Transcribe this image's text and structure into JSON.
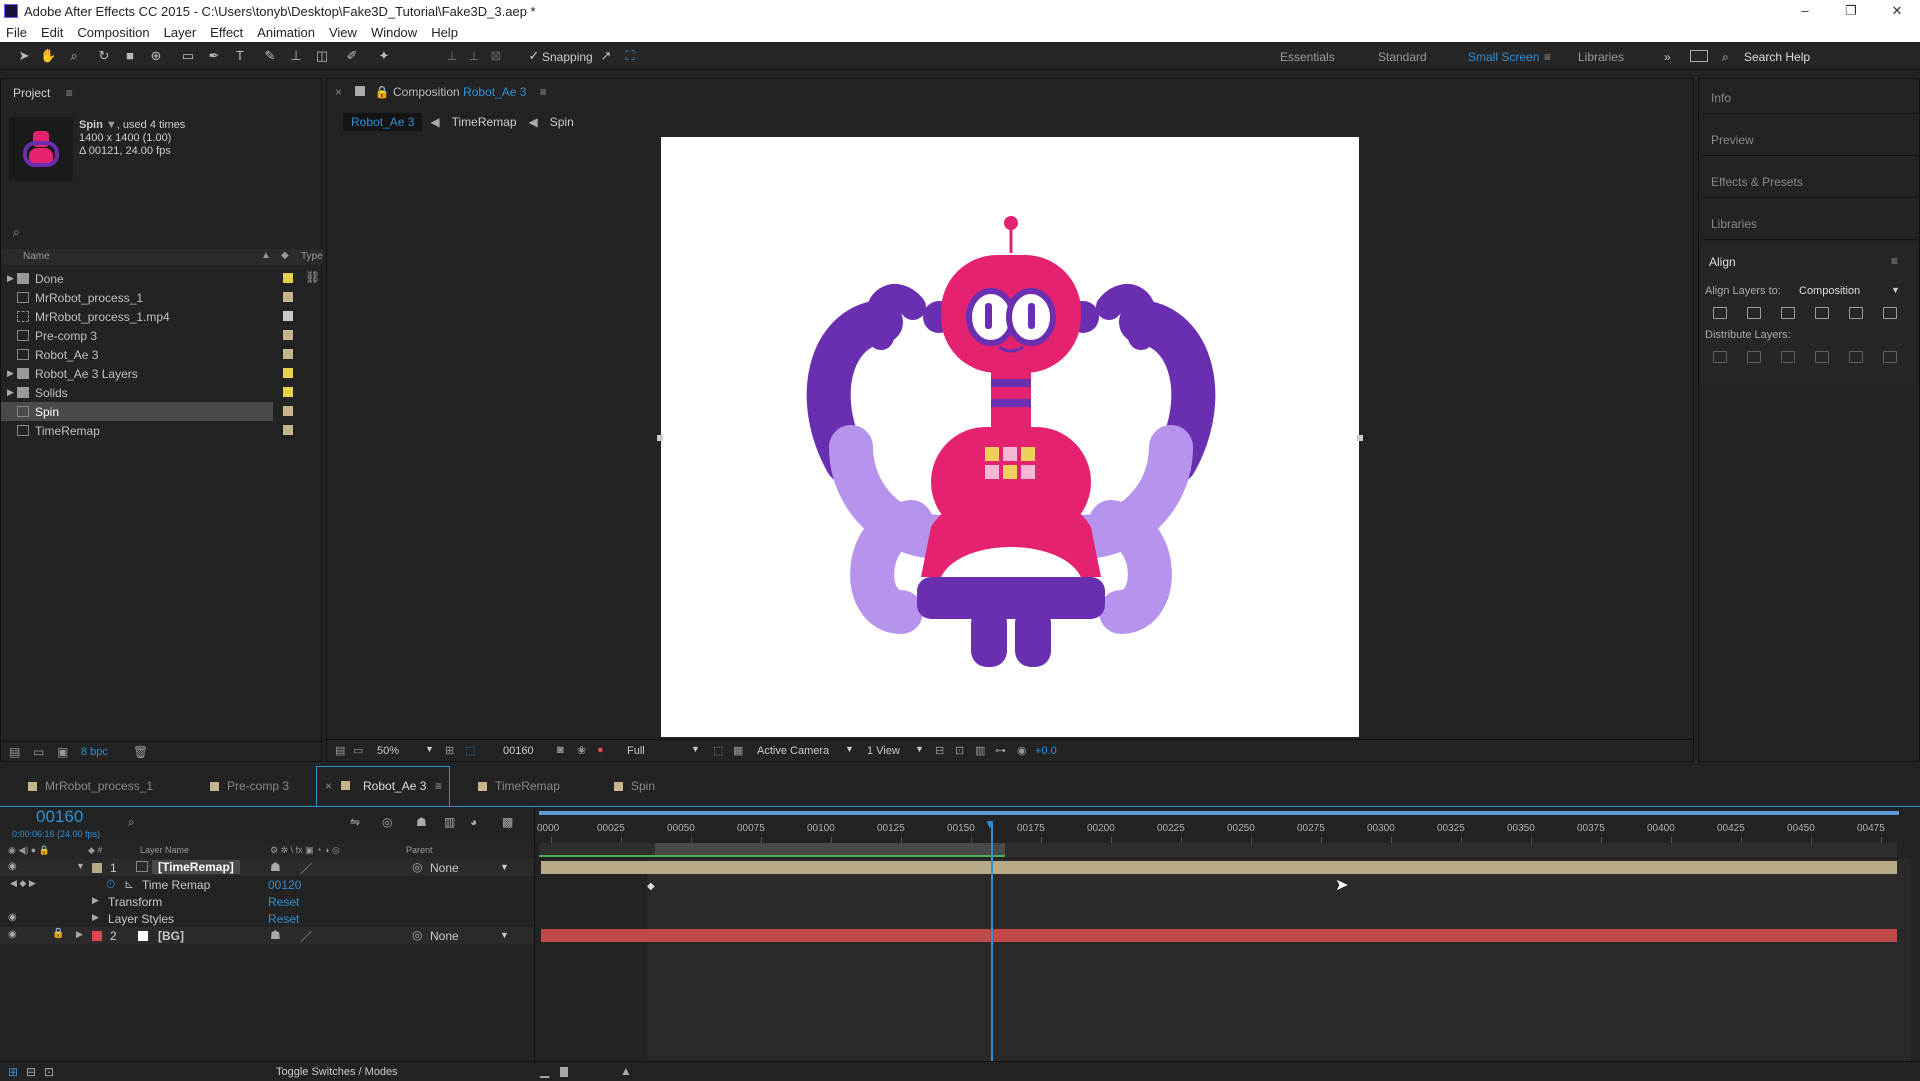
{
  "window": {
    "title": "Adobe After Effects CC 2015 - C:\\Users\\tonyb\\Desktop\\Fake3D_Tutorial\\Fake3D_3.aep *",
    "controls": [
      "–",
      "❐",
      "✕"
    ]
  },
  "menu": [
    "File",
    "Edit",
    "Composition",
    "Layer",
    "Effect",
    "Animation",
    "View",
    "Window",
    "Help"
  ],
  "toolbar": {
    "snapping_label": "Snapping",
    "workspaces": [
      "Essentials",
      "Standard",
      "Small Screen",
      "Libraries"
    ],
    "active_workspace": "Small Screen",
    "search_label": "Search Help",
    "overflow": "»"
  },
  "project": {
    "title": "Project",
    "selected": {
      "name": "Spin",
      "used": ", used 4 times",
      "dims": "1400 x 1400 (1.00)",
      "duration": "Δ 00121, 24.00 fps"
    },
    "columns": {
      "name": "Name",
      "type": "Type"
    },
    "items": [
      {
        "name": "Done",
        "kind": "folder",
        "color": "#e5d14a"
      },
      {
        "name": "MrRobot_process_1",
        "kind": "comp",
        "color": "#c8b48a"
      },
      {
        "name": "MrRobot_process_1.mp4",
        "kind": "footage",
        "color": "#c8c8c8"
      },
      {
        "name": "Pre-comp 3",
        "kind": "comp",
        "color": "#c8b48a"
      },
      {
        "name": "Robot_Ae 3",
        "kind": "comp",
        "color": "#c8b48a"
      },
      {
        "name": "Robot_Ae 3 Layers",
        "kind": "folder",
        "color": "#e5d14a"
      },
      {
        "name": "Solids",
        "kind": "folder",
        "color": "#e5d14a"
      },
      {
        "name": "Spin",
        "kind": "comp",
        "color": "#c8b48a"
      },
      {
        "name": "TimeRemap",
        "kind": "comp",
        "color": "#c8b48a"
      }
    ],
    "bpc": "8 bpc"
  },
  "composition": {
    "label": "Composition",
    "name": "Robot_Ae 3",
    "breadcrumbs": [
      "Robot_Ae 3",
      "TimeRemap",
      "Spin"
    ],
    "footer": {
      "zoom": "50%",
      "time": "00160",
      "resolution": "Full",
      "camera": "Active Camera",
      "views": "1 View",
      "exposure": "+0.0"
    }
  },
  "right_panels": {
    "collapsed": [
      "Info",
      "Preview",
      "Effects & Presets",
      "Libraries"
    ],
    "align": {
      "title": "Align",
      "align_to_label": "Align Layers to:",
      "align_to_value": "Composition",
      "distribute_label": "Distribute Layers:"
    }
  },
  "timeline": {
    "tabs": [
      "MrRobot_process_1",
      "Pre-comp 3",
      "Robot_Ae 3",
      "TimeRemap",
      "Spin"
    ],
    "active_tab": "Robot_Ae 3",
    "current_time": "00160",
    "time_sub": "0:00:06:16 (24.00 fps)",
    "columns": {
      "layer_name": "Layer Name",
      "parent": "Parent"
    },
    "ticks": [
      "0000",
      "00025",
      "00050",
      "00075",
      "00100",
      "00125",
      "00150",
      "00175",
      "00200",
      "00225",
      "00250",
      "00275",
      "00300",
      "00325",
      "00350",
      "00375",
      "00400",
      "00425",
      "00450",
      "00475"
    ],
    "layers": [
      {
        "num": "1",
        "name": "[TimeRemap]",
        "parent": "None",
        "color": "#b8a987"
      },
      {
        "num": "2",
        "name": "[BG]",
        "parent": "None",
        "color": "#d94a4a"
      }
    ],
    "props": [
      {
        "name": "Time Remap",
        "value": "00120"
      },
      {
        "name": "Transform",
        "value": "Reset"
      },
      {
        "name": "Layer Styles",
        "value": "Reset"
      }
    ],
    "toggle_label": "Toggle Switches / Modes"
  }
}
